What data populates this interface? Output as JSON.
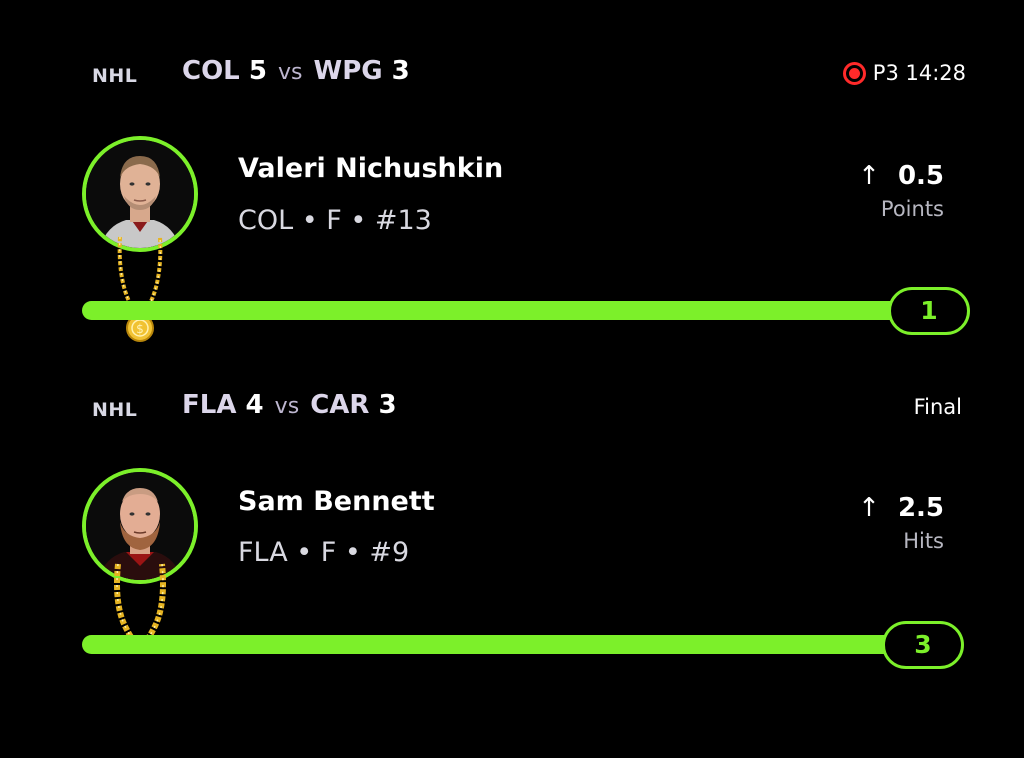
{
  "cards": [
    {
      "league": "NHL",
      "home_team": "COL",
      "home_score": "5",
      "vs": "vs",
      "away_team": "WPG",
      "away_score": "3",
      "status": "P3 14:28",
      "live": true,
      "player_name": "Valeri Nichushkin",
      "player_meta": "COL • F • #13",
      "line": "0.5",
      "direction": "over",
      "stat_label": "Points",
      "current_count": "1",
      "progress": 1.0
    },
    {
      "league": "NHL",
      "home_team": "FLA",
      "home_score": "4",
      "vs": "vs",
      "away_team": "CAR",
      "away_score": "3",
      "status": "Final",
      "live": false,
      "player_name": "Sam Bennett",
      "player_meta": "FLA • F • #9",
      "line": "2.5",
      "direction": "over",
      "stat_label": "Hits",
      "current_count": "3",
      "progress": 1.0
    }
  ],
  "colors": {
    "accent": "#7cf02a",
    "live": "#ff2a2a",
    "gold": "#f1c232",
    "background": "#000000"
  },
  "icons": {
    "live": "live-record-icon",
    "arrow": "arrow-up-icon",
    "chain": "gold-chain-icon"
  }
}
